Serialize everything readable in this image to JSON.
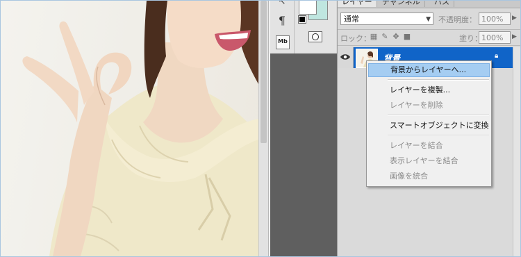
{
  "colors": {
    "accent": "#1064c8",
    "menu_hover": "#a5cdf2",
    "background_swatch": "#bfe6e0",
    "foreground_swatch": "#ffffff"
  },
  "canvas": {
    "image_icon": "woman-ok-gesture-photo"
  },
  "tools": {
    "paragraph_glyph": "¶",
    "mb_label": "Mb"
  },
  "layers_panel": {
    "tabs": [
      {
        "label": "レイヤー"
      },
      {
        "label": "チャンネル"
      },
      {
        "label": "パス"
      }
    ],
    "blend_mode": "通常",
    "opacity_label": "不透明度：",
    "opacity_value": "100%",
    "lock_label": "ロック：",
    "fill_label": "塗り：",
    "fill_value": "100%",
    "layer": {
      "name": "背景",
      "visible": true,
      "locked": true
    }
  },
  "context_menu": {
    "items": [
      {
        "label": "背景からレイヤーへ...",
        "enabled": true,
        "highlighted": true
      },
      {
        "label": "レイヤーを複製...",
        "enabled": true
      },
      {
        "label": "レイヤーを削除",
        "enabled": false
      },
      {
        "label": "スマートオブジェクトに変換",
        "enabled": true
      },
      {
        "label": "レイヤーを結合",
        "enabled": false
      },
      {
        "label": "表示レイヤーを結合",
        "enabled": false
      },
      {
        "label": "画像を統合",
        "enabled": false
      }
    ]
  }
}
